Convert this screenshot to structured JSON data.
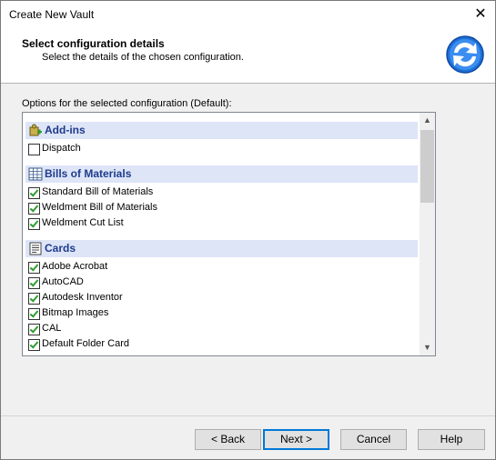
{
  "window": {
    "title": "Create New Vault",
    "close_glyph": "✕"
  },
  "header": {
    "heading": "Select configuration details",
    "subheading": "Select the details of the chosen configuration.",
    "logo_icon": "refresh-arrows-icon"
  },
  "options_label": "Options for the selected configuration (Default):",
  "groups": [
    {
      "label": "Add-ins",
      "icon": "add-in-puzzle-icon",
      "items": [
        {
          "label": "Dispatch",
          "checked": false
        }
      ]
    },
    {
      "label": "Bills of Materials",
      "icon": "table-grid-icon",
      "items": [
        {
          "label": "Standard Bill of Materials",
          "checked": true
        },
        {
          "label": "Weldment Bill of Materials",
          "checked": true
        },
        {
          "label": "Weldment Cut List",
          "checked": true
        }
      ]
    },
    {
      "label": "Cards",
      "icon": "card-icon",
      "items": [
        {
          "label": "Adobe Acrobat",
          "checked": true
        },
        {
          "label": "AutoCAD",
          "checked": true
        },
        {
          "label": "Autodesk Inventor",
          "checked": true
        },
        {
          "label": "Bitmap Images",
          "checked": true
        },
        {
          "label": "CAL",
          "checked": true
        },
        {
          "label": "Default Folder Card",
          "checked": true
        }
      ]
    }
  ],
  "buttons": {
    "back": "< Back",
    "next": "Next >",
    "cancel": "Cancel",
    "help": "Help"
  },
  "colors": {
    "group_header_bg": "#dde5f7",
    "group_header_text": "#1f3b8c",
    "check_green": "#2f9e2f",
    "default_button_border": "#0078d7"
  }
}
